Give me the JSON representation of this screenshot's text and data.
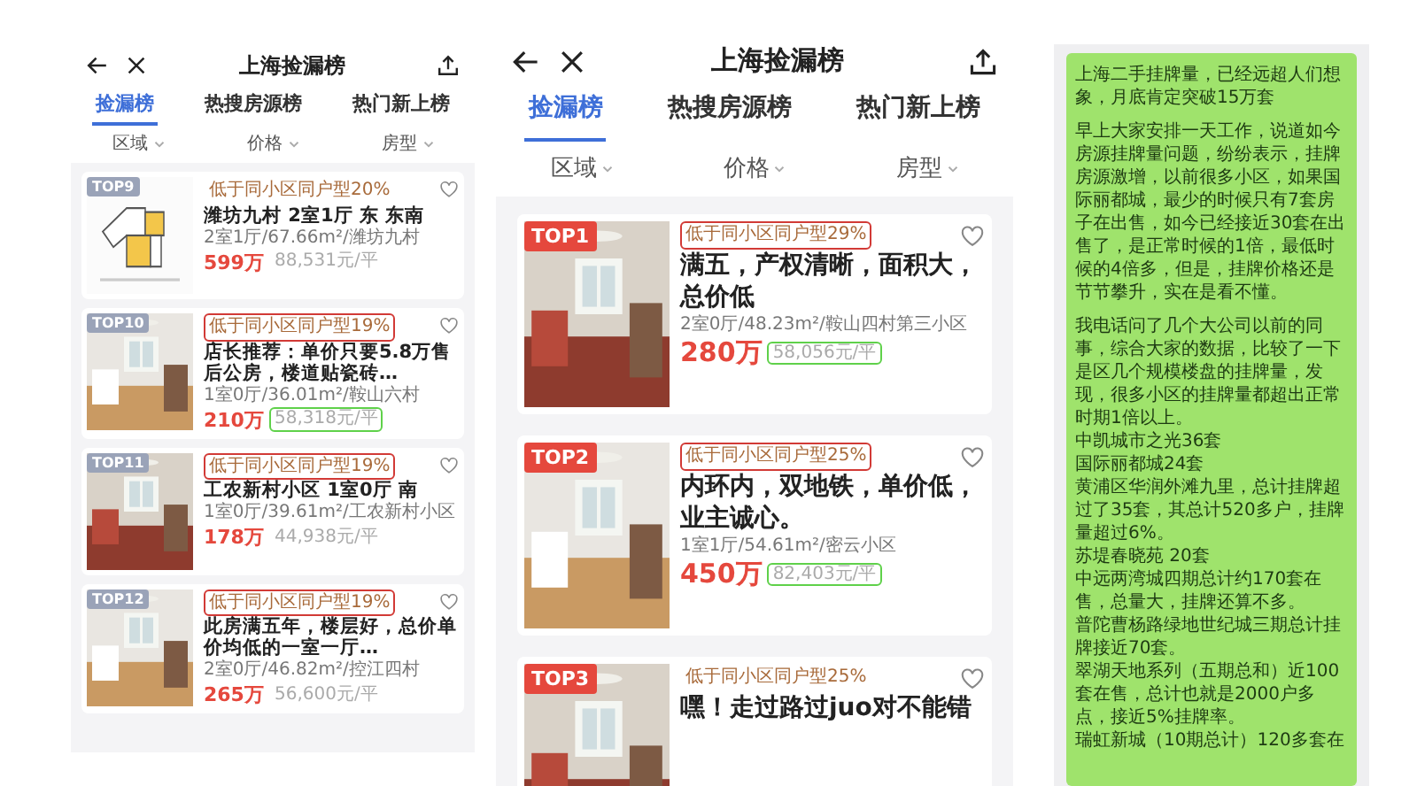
{
  "screens": [
    {
      "title": "上海捡漏榜",
      "tabs": [
        {
          "label": "捡漏榜",
          "selected": true
        },
        {
          "label": "热搜房源榜",
          "selected": false
        },
        {
          "label": "热门新上榜",
          "selected": false
        }
      ],
      "filters": [
        "区域",
        "价格",
        "房型"
      ],
      "listings": [
        {
          "rank": "TOP9",
          "color": "#9aa3b8",
          "kind": "floor_plan",
          "tag": "低于同小区同户型20%",
          "tag_circled": false,
          "title": "潍坊九村 2室1厅 东 东南",
          "details": "2室1厅/67.66m²/潍坊九村",
          "price": "599万",
          "unit_price": "88,531元/平",
          "unit_price_circled": false
        },
        {
          "rank": "TOP10",
          "color": "#9aa3b8",
          "tag": "低于同小区同户型19%",
          "tag_circled": true,
          "title": "店长推荐：单价只要5.8万售后公房，楼道贴瓷砖…",
          "details": "1室0厅/36.01m²/鞍山六村",
          "price": "210万",
          "unit_price": "58,318元/平",
          "unit_price_circled": true
        },
        {
          "rank": "TOP11",
          "color": "#9aa3b8",
          "tag": "低于同小区同户型19%",
          "tag_circled": true,
          "title": "工农新村小区 1室0厅 南",
          "details": "1室0厅/39.61m²/工农新村小区",
          "price": "178万",
          "unit_price": "44,938元/平",
          "unit_price_circled": false
        },
        {
          "rank": "TOP12",
          "color": "#9aa3b8",
          "tag": "低于同小区同户型19%",
          "tag_circled": true,
          "title": "此房满五年，楼层好，总价单价均低的一室一厅…",
          "details": "2室0厅/46.82m²/控江四村",
          "price": "265万",
          "unit_price": "56,600元/平",
          "unit_price_circled": false
        }
      ]
    },
    {
      "title": "上海捡漏榜",
      "tabs": [
        {
          "label": "捡漏榜",
          "selected": true
        },
        {
          "label": "热搜房源榜",
          "selected": false
        },
        {
          "label": "热门新上榜",
          "selected": false
        }
      ],
      "filters": [
        "区域",
        "价格",
        "房型"
      ],
      "listings": [
        {
          "rank": "TOP1",
          "color": "#e5483d",
          "tag": "低于同小区同户型29%",
          "tag_circled": true,
          "title": "满五，产权清晰，面积大，总价低",
          "details": "2室0厅/48.23m²/鞍山四村第三小区",
          "price": "280万",
          "unit_price": "58,056元/平",
          "unit_price_circled": true
        },
        {
          "rank": "TOP2",
          "color": "#e5483d",
          "tag": "低于同小区同户型25%",
          "tag_circled": true,
          "title": "内环内，双地铁，单价低，业主诚心。",
          "details": "1室1厅/54.61m²/密云小区",
          "price": "450万",
          "unit_price": "82,403元/平",
          "unit_price_circled": true
        },
        {
          "rank": "TOP3",
          "color": "#e5483d",
          "tag": "低于同小区同户型25%",
          "tag_circled": false,
          "title": "嘿！走过路过juo对不能错"
        }
      ]
    }
  ],
  "message": {
    "paragraphs": [
      "上海二手挂牌量，已经远超人们想象，月底肯定突破15万套",
      "早上大家安排一天工作，说道如今房源挂牌量问题，纷纷表示，挂牌房源激增，以前很多小区，如果国际丽都城，最少的时候只有7套房子在出售，如今已经接近30套在出售了，是正常时候的1倍，最低时候的4倍多，但是，挂牌价格还是节节攀升，实在是看不懂。",
      "我电话问了几个大公司以前的同事，综合大家的数据，比较了一下是区几个规模楼盘的挂牌量，发现，很多小区的挂牌量都超出正常时期1倍以上。",
      "中凯城市之光36套",
      "国际丽都城24套",
      "黄浦区华润外滩九里，总计挂牌超过了35套，其总计520多户，挂牌量超过6%。",
      "苏堤春晓苑 20套",
      "中远两湾城四期总计约170套在售，总量大，挂牌还算不多。",
      "普陀曹杨路绿地世纪城三期总计挂牌接近70套。",
      "翠湖天地系列（五期总和）近100套在售，总计也就是2000户多点，接近5%挂牌率。",
      "瑞虹新城（10期总计）120多套在"
    ]
  }
}
